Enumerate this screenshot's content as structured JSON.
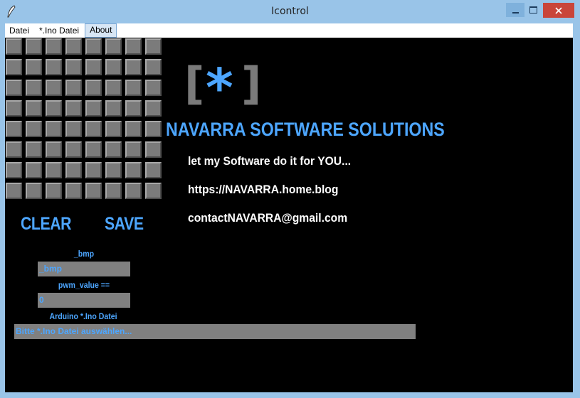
{
  "window": {
    "title": "Icontrol",
    "icon": "feather-icon",
    "controls": [
      "minimize-icon",
      "maximize-icon",
      "close-icon"
    ]
  },
  "menu": {
    "items": [
      "Datei",
      "*.Ino Datei",
      "About"
    ],
    "active": "About"
  },
  "grid": {
    "rows": 8,
    "cols": 8
  },
  "buttons": {
    "clear": "CLEAR",
    "save": "SAVE"
  },
  "bmp": {
    "label": "_bmp",
    "value": "_bmp"
  },
  "pwm": {
    "label": "pwm_value ==",
    "value": "0"
  },
  "ino": {
    "label": "Arduino *.Ino Datei",
    "value": "Bitte *.Ino Datei auswählen..."
  },
  "logo": {
    "bracket_open": "[",
    "star": "*",
    "bracket_close": "]"
  },
  "company": "NAVARRA SOFTWARE SOLUTIONS",
  "tagline": "let my Software do it for YOU...",
  "website": "https://NAVARRA.home.blog",
  "email": "contactNAVARRA@gmail.com",
  "colors": {
    "accent": "#4da6ff",
    "background": "#000000",
    "cell": "#7b7b7b",
    "field": "#808080",
    "titlebar": "#99c4e8",
    "close": "#c9453a"
  }
}
